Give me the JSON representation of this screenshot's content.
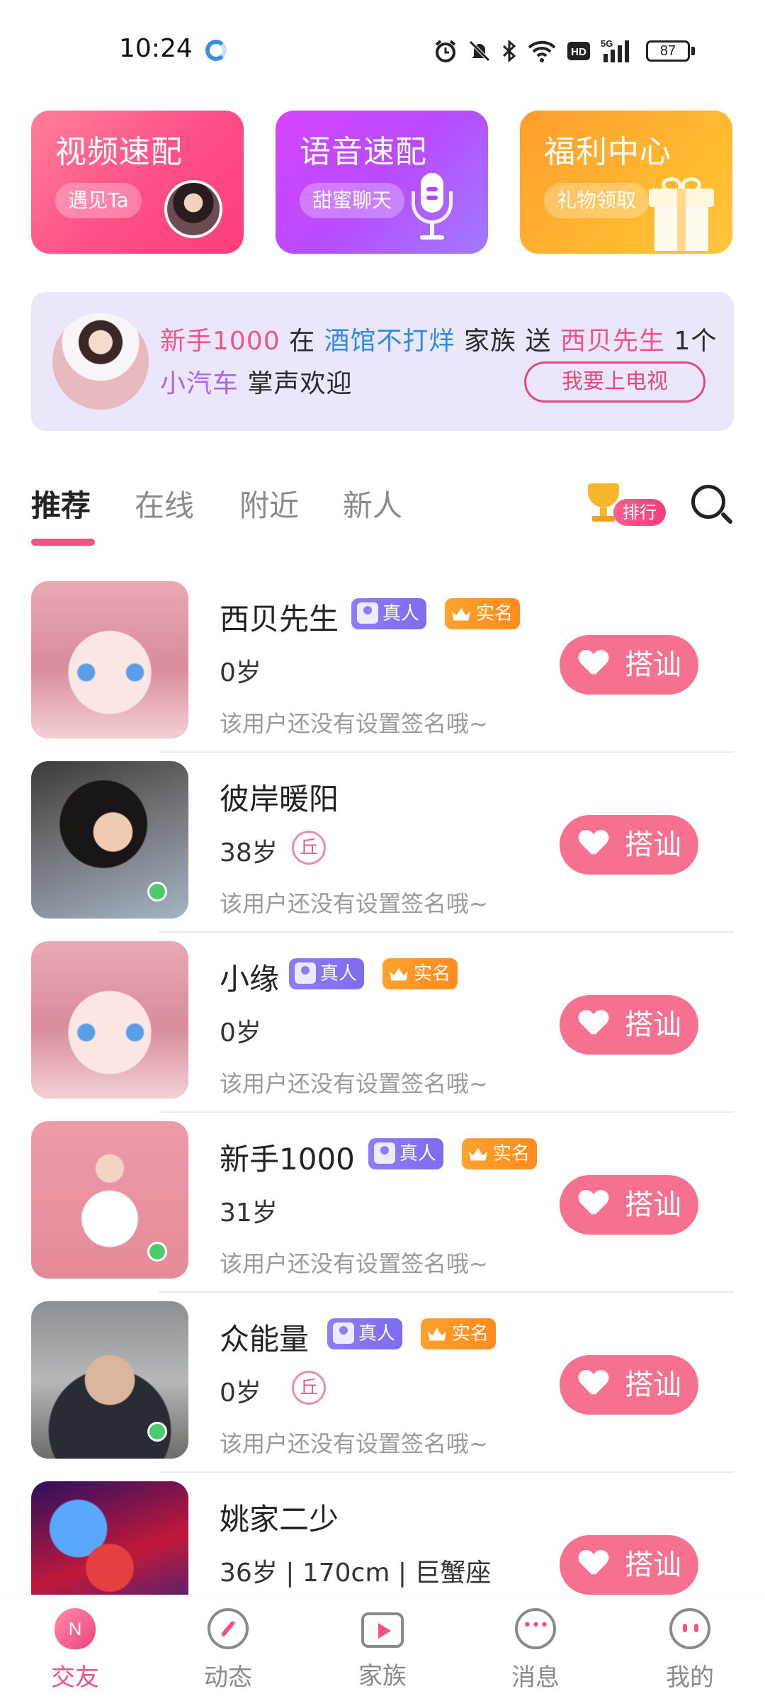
{
  "status_bar": {
    "time": "10:24",
    "icons": [
      "alarm-icon",
      "mute-icon",
      "bluetooth-icon",
      "wifi-icon",
      "hd-icon",
      "5g-signal-icon"
    ],
    "battery": "87"
  },
  "feature_cards": [
    {
      "title": "视频速配",
      "subtitle": "遇见Ta",
      "icon": "avatar-thumbnail"
    },
    {
      "title": "语音速配",
      "subtitle": "甜蜜聊天",
      "icon": "microphone-icon"
    },
    {
      "title": "福利中心",
      "subtitle": "礼物领取",
      "icon": "gift-icon"
    }
  ],
  "banner": {
    "sender": "新手1000",
    "word_at": "在",
    "family": "酒馆不打烊",
    "word_family": "家族",
    "word_give": "送",
    "receiver": "西贝先生",
    "gift_count": "1个",
    "gift": "小汽车",
    "applause": "掌声欢迎",
    "tv_button": "我要上电视"
  },
  "tabs": [
    {
      "label": "推荐",
      "active": true
    },
    {
      "label": "在线",
      "active": false
    },
    {
      "label": "附近",
      "active": false
    },
    {
      "label": "新人",
      "active": false
    }
  ],
  "rank_label": "排行",
  "colors": {
    "accent": "#f25282",
    "greet_button": "#f5718f",
    "online_dot": "#4ccb6a",
    "real_badge": "#8f7cf5",
    "verified_badge": "#ff9a27"
  },
  "badges": {
    "real": "真人",
    "verified": "实名"
  },
  "greet_label": "搭讪",
  "users": [
    {
      "name": "西贝先生",
      "age": "0岁",
      "signature": "该用户还没有设置签名哦~",
      "real": true,
      "verified": true,
      "online": false,
      "level": "",
      "avatar": "anime-girl"
    },
    {
      "name": "彼岸暖阳",
      "age": "38岁",
      "signature": "该用户还没有设置签名哦~",
      "real": false,
      "verified": false,
      "online": true,
      "level": "丘",
      "avatar": "girl-photo"
    },
    {
      "name": "小缘",
      "age": "0岁",
      "signature": "该用户还没有设置签名哦~",
      "real": true,
      "verified": true,
      "online": false,
      "level": "",
      "avatar": "anime-girl"
    },
    {
      "name": "新手1000",
      "age": "31岁",
      "signature": "该用户还没有设置签名哦~",
      "real": true,
      "verified": true,
      "online": true,
      "level": "",
      "avatar": "pink-photo"
    },
    {
      "name": "众能量",
      "age": "0岁",
      "signature": "该用户还没有设置签名哦~",
      "real": true,
      "verified": true,
      "online": true,
      "level": "丘",
      "avatar": "man-photo"
    },
    {
      "name": "姚家二少",
      "age": "36岁 | 170cm | 巨蟹座",
      "signature": "",
      "real": false,
      "verified": false,
      "online": false,
      "level": "",
      "avatar": "dragon-art"
    }
  ],
  "bottom_nav": [
    {
      "label": "交友",
      "icon": "friends-icon",
      "active": true
    },
    {
      "label": "动态",
      "icon": "compass-icon",
      "active": false
    },
    {
      "label": "家族",
      "icon": "tv-icon",
      "active": false
    },
    {
      "label": "消息",
      "icon": "chat-icon",
      "active": false
    },
    {
      "label": "我的",
      "icon": "face-icon",
      "active": false
    }
  ]
}
